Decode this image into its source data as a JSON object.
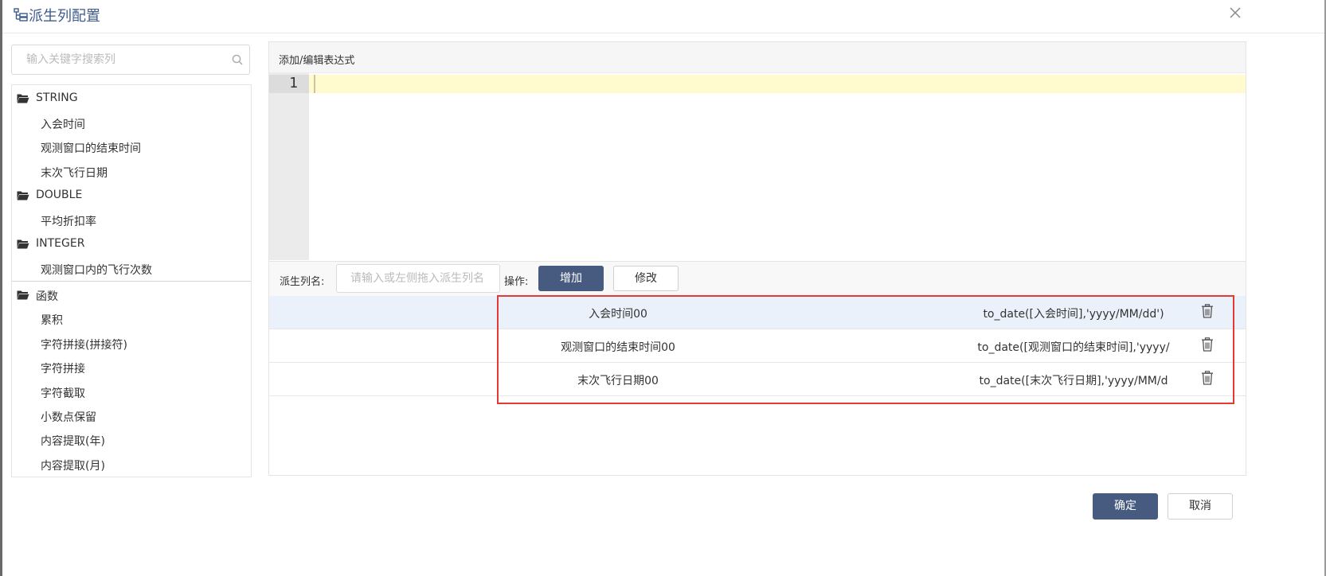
{
  "dialog": {
    "title": "派生列配置",
    "title_icon": "list-tree-icon",
    "close_icon": "close-icon"
  },
  "search": {
    "placeholder": "输入关键字搜索列",
    "icon": "search-icon"
  },
  "tree": {
    "folder_icon": "folder-open-icon",
    "groups": [
      {
        "label": "STRING",
        "items": [
          "入会时间",
          "观测窗口的结束时间",
          "末次飞行日期"
        ]
      },
      {
        "label": "DOUBLE",
        "items": [
          "平均折扣率"
        ]
      },
      {
        "label": "INTEGER",
        "items": [
          "观测窗口内的飞行次数"
        ]
      },
      {
        "label": "函数",
        "items": [
          "累积",
          "字符拼接(拼接符)",
          "字符拼接",
          "字符截取",
          "小数点保留",
          "内容提取(年)",
          "内容提取(月)"
        ]
      }
    ]
  },
  "editor": {
    "header": "添加/编辑表达式",
    "line_number": "1",
    "code": ""
  },
  "form": {
    "name_label": "派生列名:",
    "name_placeholder": "请输入或左侧拖入派生列名",
    "op_label": "操作:",
    "add_button": "增加",
    "edit_button": "修改"
  },
  "expressions": [
    {
      "name": "入会时间00",
      "formula": "to_date([入会时间],'yyyy/MM/dd')",
      "selected": true
    },
    {
      "name": "观测窗口的结束时间00",
      "formula": "to_date([观测窗口的结束时间],'yyyy/",
      "selected": false
    },
    {
      "name": "末次飞行日期00",
      "formula": "to_date([末次飞行日期],'yyyy/MM/d",
      "selected": false
    }
  ],
  "delete_icon": "trash-icon",
  "footer": {
    "ok_button": "确定",
    "cancel_button": "取消"
  },
  "colors": {
    "primary": "#475a80",
    "title": "#3e5a8e",
    "selected_row": "#eaf1fb",
    "active_line": "#fffbcf",
    "highlight": "#e53935"
  }
}
